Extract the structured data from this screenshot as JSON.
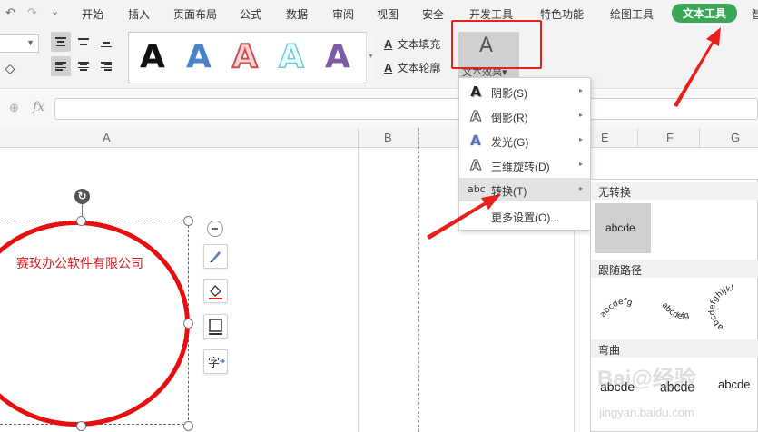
{
  "quick_access": {
    "undo": "↶",
    "redo": "↷",
    "more": "⌄"
  },
  "menu": {
    "tabs": [
      "开始",
      "插入",
      "页面布局",
      "公式",
      "数据",
      "审阅",
      "视图",
      "安全",
      "开发工具",
      "特色功能",
      "绘图工具",
      "文本工具",
      "智"
    ],
    "active_color": "#3ba65a"
  },
  "ribbon": {
    "gallery": {
      "letters": [
        "A",
        "A",
        "A",
        "A",
        "A"
      ],
      "colors": [
        "#111111",
        "#4a83c6",
        "#ffffff",
        "#ffffff",
        "#7b5aa6"
      ]
    },
    "text_fill": "文本填充",
    "text_outline": "文本轮廓",
    "text_effect": "文本效果",
    "arrow_down": "▾"
  },
  "formula_bar": {
    "fx": "fx"
  },
  "columns": {
    "A": "A",
    "B": "B",
    "E": "E",
    "F": "F",
    "G": "G"
  },
  "shape": {
    "text": "赛玫办公软件有限公司",
    "border_color": "#e60f0f",
    "text_color": "#d42020"
  },
  "dropdown": {
    "items": [
      {
        "label": "阴影(S)",
        "icon": "A",
        "has_sub": true
      },
      {
        "label": "倒影(R)",
        "icon": "A",
        "has_sub": true
      },
      {
        "label": "发光(G)",
        "icon": "A",
        "has_sub": true
      },
      {
        "label": "三维旋转(D)",
        "icon": "A",
        "has_sub": true
      },
      {
        "label": "转换(T)",
        "icon": "abc",
        "has_sub": true
      },
      {
        "label": "更多设置(O)...",
        "icon": "",
        "has_sub": false
      }
    ],
    "submenu_arrow": "▸"
  },
  "submenu": {
    "no_transform": "无转换",
    "no_transform_sample": "abcde",
    "follow_path": "跟随路径",
    "path_samples": [
      "abcdefg",
      "abcdefg",
      "abcdefghijkl"
    ],
    "warp": "弯曲",
    "warp_samples": [
      "abcde",
      "abcde",
      "abcde"
    ]
  },
  "watermark": {
    "logo": "Bai@经验",
    "url": "jingyan.baidu.com"
  }
}
